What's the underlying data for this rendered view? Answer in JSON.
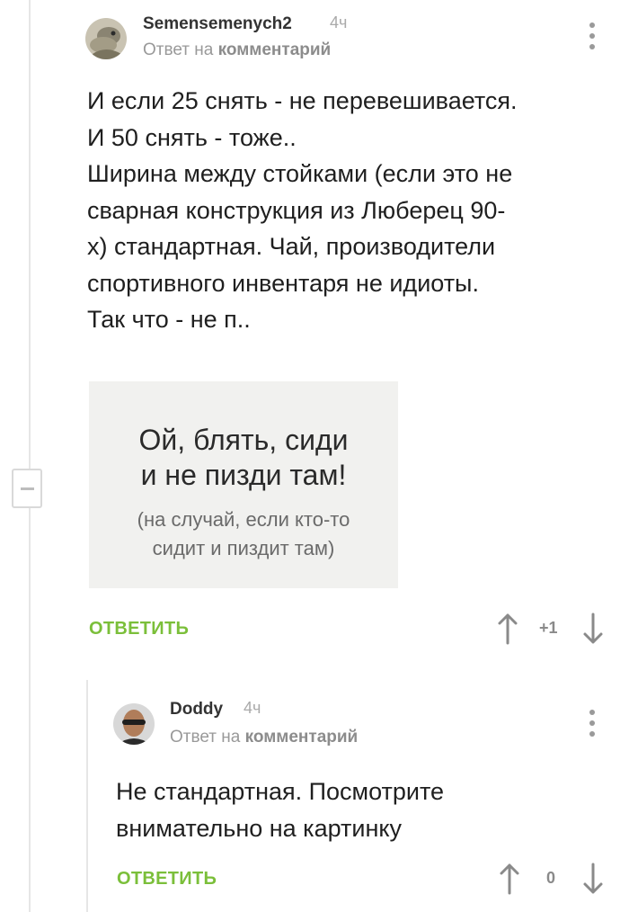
{
  "comments": [
    {
      "author": "Semensemenych2",
      "time": "4ч",
      "reply_prefix": "Ответ на",
      "reply_target": "комментарий",
      "body_lines": [
        "И если 25 снять - не перевешивается.",
        "И 50 снять - тоже..",
        "Ширина между стойками (если это не",
        "сварная конструкция из Люберец 90-",
        "х) стандартная.  Чай, производители",
        "спортивного инвентаря не идиоты.",
        "Так что - не п.."
      ],
      "image_text": {
        "line1": "Ой, блять, сиди",
        "line2": "и не пизди там!",
        "line3": "(на случай, если кто-то",
        "line4": "сидит и пиздит там)"
      },
      "reply_label": "ОТВЕТИТЬ",
      "rating": "+1",
      "upvote_icon": "arrow-up-icon",
      "downvote_icon": "arrow-down-icon"
    },
    {
      "author": "Doddy",
      "time": "4ч",
      "reply_prefix": "Ответ на",
      "reply_target": "комментарий",
      "body_lines": [
        "Не стандартная. Посмотрите",
        "внимательно на картинку"
      ],
      "reply_label": "ОТВЕТИТЬ",
      "rating": "0",
      "upvote_icon": "arrow-up-icon",
      "downvote_icon": "arrow-down-icon"
    }
  ],
  "colors": {
    "accent_green": "#7bbf3a",
    "muted_text": "#999999",
    "thread_line": "#e6e6e6"
  }
}
